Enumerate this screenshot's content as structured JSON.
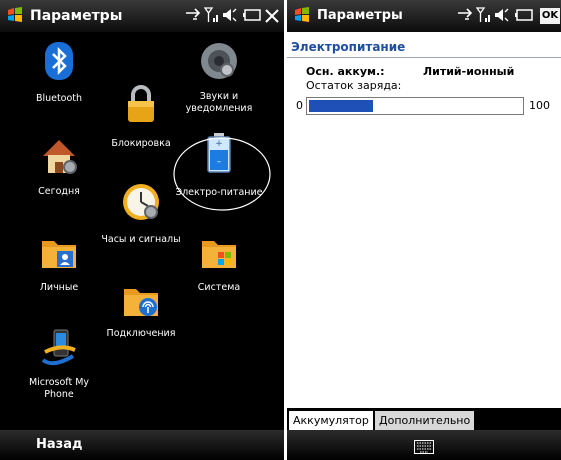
{
  "left_panel": {
    "title": "Параметры",
    "tiles": {
      "bluetooth": "Bluetooth",
      "sounds": "Звуки и уведомления",
      "lock": "Блокировка",
      "today": "Сегодня",
      "power": "Электро-питание",
      "clock": "Часы и сигналы",
      "personal": "Личные",
      "system": "Система",
      "connections": "Подключения",
      "phone": "Microsoft My Phone"
    },
    "back_label": "Назад"
  },
  "right_panel": {
    "title": "Параметры",
    "ok_label": "ok",
    "section_title": "Электропитание",
    "battery_label": "Осн. аккум.:",
    "battery_type": "Литий-ионный",
    "charge_label": "Остаток заряда:",
    "scale_min": "0",
    "scale_max": "100",
    "charge_fraction": 0.3,
    "tabs": [
      "Аккумулятор",
      "Дополнительно"
    ]
  },
  "colors": {
    "accent_blue": "#1e4f9f",
    "progress_fill": "#1e50b8",
    "power_highlight_ring": "#ffffff"
  }
}
